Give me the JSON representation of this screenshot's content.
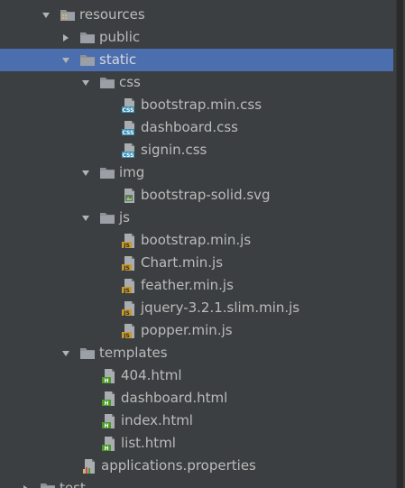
{
  "colors": {
    "background": "#3c3f41",
    "selection": "#4b6eaf",
    "text": "#bbbbbb",
    "folder": "#8c9197",
    "css_badge": "#3a8fb7",
    "js_badge": "#c79a2c",
    "html_badge": "#4c9a2a"
  },
  "tree": {
    "resources": {
      "label": "resources",
      "icon": "resources-folder-icon",
      "expanded": true
    },
    "public": {
      "label": "public",
      "icon": "folder-icon",
      "expanded": false
    },
    "static": {
      "label": "static",
      "icon": "folder-icon",
      "expanded": true,
      "selected": true
    },
    "css": {
      "label": "css",
      "icon": "folder-icon",
      "expanded": true
    },
    "css_files": [
      {
        "label": "bootstrap.min.css",
        "icon": "css-file-icon"
      },
      {
        "label": "dashboard.css",
        "icon": "css-file-icon"
      },
      {
        "label": "signin.css",
        "icon": "css-file-icon"
      }
    ],
    "img": {
      "label": "img",
      "icon": "folder-icon",
      "expanded": true
    },
    "img_files": [
      {
        "label": "bootstrap-solid.svg",
        "icon": "svg-file-icon"
      }
    ],
    "js": {
      "label": "js",
      "icon": "folder-icon",
      "expanded": true
    },
    "js_files": [
      {
        "label": "bootstrap.min.js",
        "icon": "js-file-icon"
      },
      {
        "label": "Chart.min.js",
        "icon": "js-file-icon"
      },
      {
        "label": "feather.min.js",
        "icon": "js-file-icon"
      },
      {
        "label": "jquery-3.2.1.slim.min.js",
        "icon": "js-file-icon"
      },
      {
        "label": "popper.min.js",
        "icon": "js-file-icon"
      }
    ],
    "templates": {
      "label": "templates",
      "icon": "folder-icon",
      "expanded": true
    },
    "template_files": [
      {
        "label": "404.html",
        "icon": "html-file-icon"
      },
      {
        "label": "dashboard.html",
        "icon": "html-file-icon"
      },
      {
        "label": "index.html",
        "icon": "html-file-icon"
      },
      {
        "label": "list.html",
        "icon": "html-file-icon"
      }
    ],
    "properties_file": {
      "label": "applications.properties",
      "icon": "properties-file-icon"
    },
    "test": {
      "label": "test",
      "icon": "folder-icon",
      "expanded": false
    }
  }
}
